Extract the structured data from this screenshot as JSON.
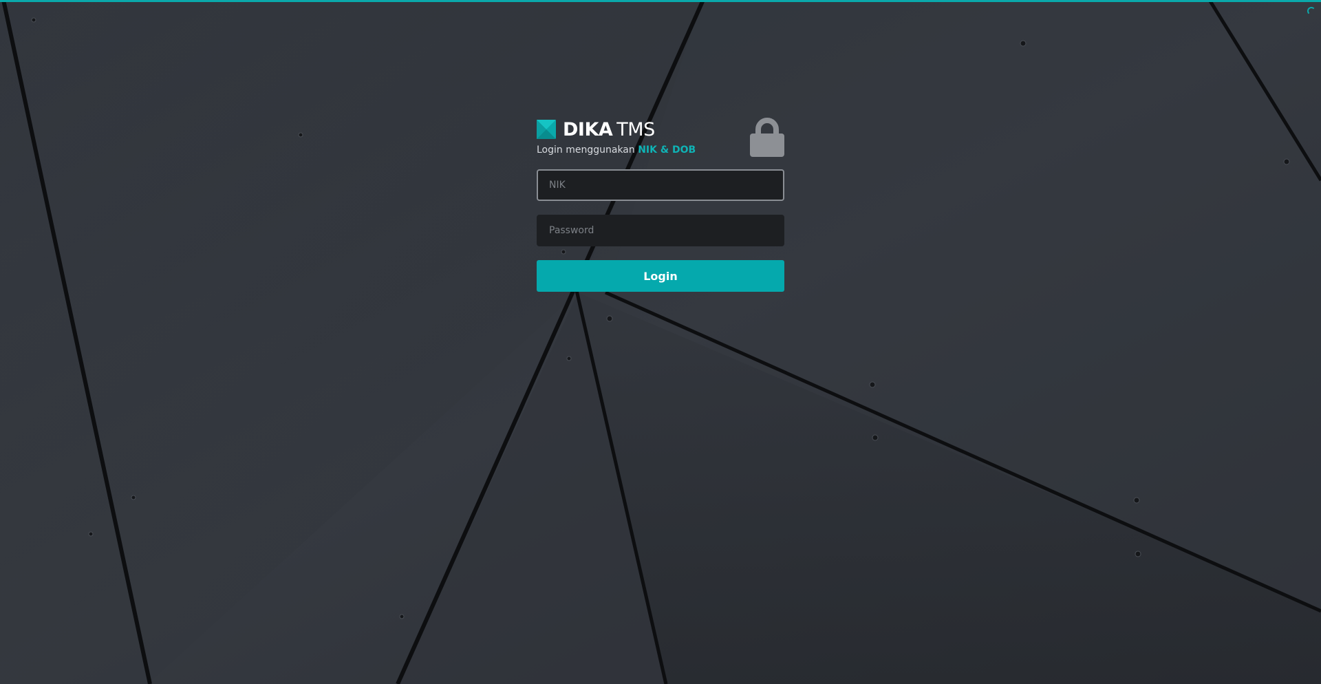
{
  "brand": {
    "name_bold": "DIKA",
    "name_light": "TMS",
    "logo_icon": "teal-square-logo-icon"
  },
  "subtitle": {
    "prefix": "Login menggunakan",
    "highlight": "NIK & DOB"
  },
  "lock": {
    "icon": "padlock-icon"
  },
  "form": {
    "nik_placeholder": "NIK",
    "nik_value": "",
    "password_placeholder": "Password",
    "password_value": "",
    "login_label": "Login"
  },
  "colors": {
    "accent": "#05a9ad",
    "background": "#30343b",
    "field_background": "#1d1f22"
  }
}
